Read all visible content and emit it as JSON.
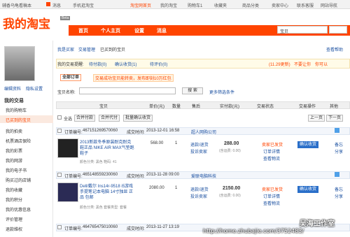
{
  "topbar": {
    "left_text": "辅香乌龟看稿本",
    "msg_label": "消息",
    "mobile": "手机逛淘宝",
    "my_taobao": "淘宝网首页",
    "my_taobao2": "我的淘宝",
    "cart": "购物车1",
    "fav": "收藏夹",
    "category": "商品分类",
    "seller": "卖家中心",
    "service": "联系客服",
    "sitemap": "网站导航"
  },
  "header": {
    "logo": "我的淘宝",
    "beta": "Beta",
    "nav": [
      "首页",
      "个人主页",
      "设置",
      "消息"
    ],
    "search_placeholder": "宝贝",
    "search_btn": "搜索"
  },
  "sidebar": {
    "edit": "编辑资料",
    "privacy": "隐私设置",
    "section": "我的交易",
    "items": [
      "我的购物车",
      "已买到的宝贝",
      "我的拍卖",
      "机票酒店保险",
      "我的彩票",
      "我的网游",
      "我的电子书",
      "购买过的店铺",
      "我的收藏",
      "我的积分",
      "我的优惠信息",
      "评价管理",
      "退款维权"
    ]
  },
  "breadcrumb": {
    "a": "我是买家",
    "b": "交易管理",
    "c": "已买到的宝贝",
    "right": "查看帮助"
  },
  "reminders": {
    "label": "我的交易提醒:",
    "items": [
      "待付款(0)",
      "确认收货(1)",
      "待评价(0)"
    ],
    "right": "(11.29更新)",
    "right2": "不要让你",
    "right3": "你可以"
  },
  "filter": {
    "all_orders": "全部订单",
    "notice": "交易成功宝贝能转卖，发布即刻10万红包",
    "search_label": "宝贝名称:",
    "search_btn": "搜 索",
    "more": "更多筛选条件"
  },
  "table_header": [
    "宝贝",
    "单价(元)",
    "数量",
    "售后",
    "实付款(元)",
    "交易状态",
    "交易操作",
    "其他"
  ],
  "bulk": {
    "select_all": "全选",
    "merge_pay": "合并付款",
    "merge_proxy": "合并代付",
    "batch_confirm": "批量确认收货",
    "prev": "上一页",
    "next": "下一页"
  },
  "orders": [
    {
      "order_label": "订单编号:",
      "order_no": "467151269570060",
      "time_label": "成交时间:",
      "time": "2013-12-01 16:58",
      "shop": "超人网购公司",
      "title": "2013新款冬季原装耐克耐克鞋正品 NIKE AIR MAX气垫跑鞋子",
      "spec": "颜色分类: 黑色  鞋码: 41",
      "price": "568.00",
      "qty": "1",
      "after": "退款/退货",
      "after2": "投诉卖家",
      "paid": "288.00",
      "paid_note": "(含运费: 0.00)",
      "status": "卖家已发货",
      "status2": "订单详情",
      "status3": "查看物流",
      "action": "确认收货",
      "other": "备忘",
      "other2": "分享"
    },
    {
      "order_label": "订单编号:",
      "order_no": "465148559230060",
      "time_label": "成交时间:",
      "time": "2013-11-28 09:00",
      "shop": "爱联电脑科技",
      "title": "Dell/戴尔 Ins14r-9518 i5游戏手提笔记本电脑 14寸独显 正品 包邮",
      "spec": "颜色分类: 黑色  套餐类型: 套餐",
      "price": "2080.00",
      "qty": "1",
      "after": "退款/退货",
      "after2": "投诉卖家",
      "paid": "2150.00",
      "paid_note": "(含运费: 0.00)",
      "status": "卖家已发货",
      "status2": "订单详情",
      "status3": "查看物流",
      "action": "确认收货",
      "other": "备忘",
      "other2": "分享"
    },
    {
      "order_label": "订单编号:",
      "order_no": "464765475010060",
      "time_label": "成交时间:",
      "time": "2013-11-27 13:19",
      "shop": "",
      "title": "",
      "spec": "",
      "price": "",
      "qty": "",
      "after": "",
      "after2": "",
      "paid": "",
      "paid_note": "",
      "status": "",
      "status2": "",
      "status3": "",
      "action": "",
      "other": "",
      "other2": ""
    }
  ],
  "watermark": {
    "line1": "吴海工作室",
    "line2": "http://home.zhubajie.com/3752483/"
  },
  "colors": {
    "brand": "#ff4400",
    "link": "#1a4fa0",
    "button": "#2a6fc9"
  }
}
